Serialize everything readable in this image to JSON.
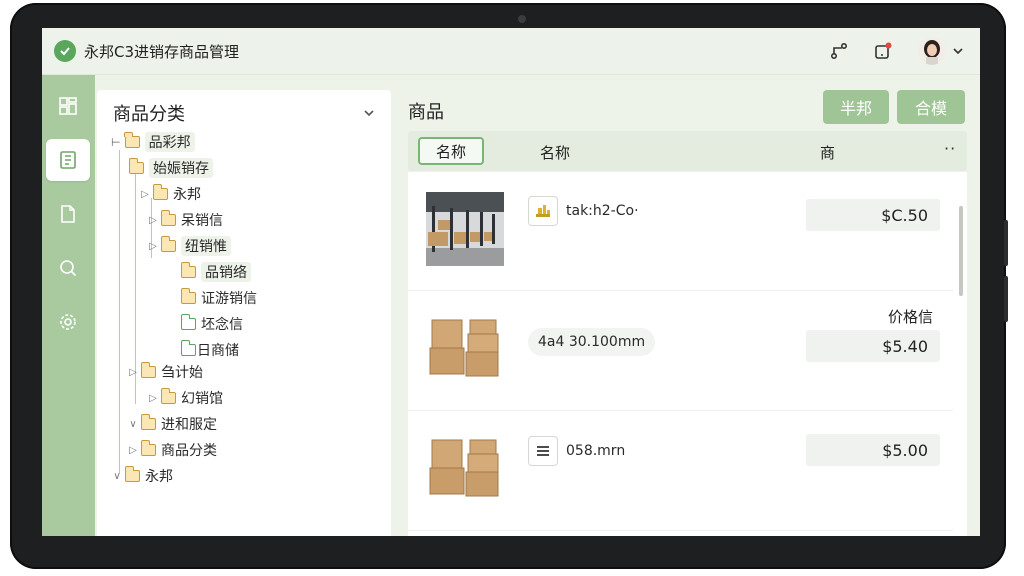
{
  "app": {
    "title": "永邦C3进销存商品管理"
  },
  "colors": {
    "accent": "#9fc596",
    "rail": "#a9c99f",
    "brand_logo": "#5aa65c",
    "folder": "#c79a3c"
  },
  "rail": {
    "icons": [
      "dashboard-icon",
      "book-icon",
      "document-icon",
      "search-icon",
      "settings-icon"
    ],
    "active_index": 1
  },
  "category_panel": {
    "title": "商品分类",
    "nodes": [
      {
        "label": "品彩邦",
        "arrow": ""
      },
      {
        "label": "始娠销存",
        "arrow": ""
      },
      {
        "label": "永邦",
        "arrow": "▷"
      },
      {
        "label": "呆销信",
        "arrow": "▷"
      },
      {
        "label": "纽销惟",
        "arrow": "▷"
      },
      {
        "label": "品销络",
        "arrow": ""
      },
      {
        "label": "证游销信",
        "arrow": ""
      },
      {
        "label": "坯念信",
        "arrow": ""
      },
      {
        "label": "日商储",
        "arrow": ""
      },
      {
        "label": "刍计始",
        "arrow": "▷"
      },
      {
        "label": "幻销馆",
        "arrow": "▷"
      },
      {
        "label": "进和服定",
        "arrow": "∨"
      },
      {
        "label": "商品分类",
        "arrow": "▷"
      },
      {
        "label": "永邦",
        "arrow": "∨"
      }
    ]
  },
  "products_panel": {
    "title": "商品",
    "buttons": [
      {
        "label": "半邦"
      },
      {
        "label": "合模"
      }
    ],
    "columns": {
      "tab": "名称",
      "name": "名称",
      "third": "商",
      "more": "··"
    },
    "price_label": "价格信",
    "rows": [
      {
        "sku": "tak:h2-Co·",
        "icon": "shelf-icon",
        "price": "$C.50",
        "image": "warehouse"
      },
      {
        "sku": "4a4 30.100mm",
        "icon": "",
        "price": "$5.40",
        "image": "boxes"
      },
      {
        "sku": "058.mrn",
        "icon": "list-icon",
        "price": "$5.00",
        "image": "boxes"
      }
    ]
  }
}
